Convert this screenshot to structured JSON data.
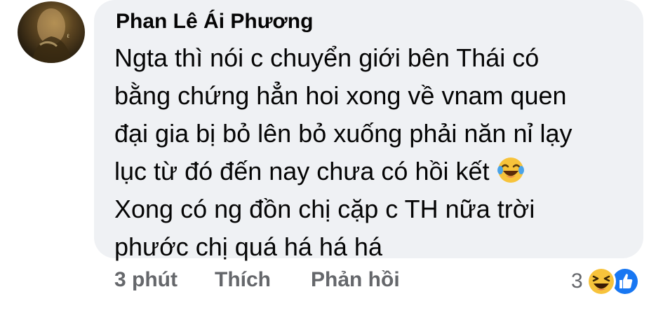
{
  "comment": {
    "author": "Phan Lê Ái Phương",
    "lines": [
      "Ngta thì nói c chuyển giới bên Thái có",
      "bằng chứng hẳn hoi xong về vnam quen",
      "đại gia bị bỏ lên bỏ xuống phải năn nỉ lạy",
      "lục từ đó đến nay chưa có hồi kết",
      "Xong có ng đồn chị cặp c TH nữa trời",
      "phước chị quá há há há"
    ],
    "inline_emoji": "laughing-tears-emoji"
  },
  "actions": {
    "time": "3 phút",
    "like": "Thích",
    "reply": "Phản hồi"
  },
  "reactions": {
    "count": "3",
    "icons": [
      "haha-reaction-icon",
      "like-reaction-icon"
    ]
  },
  "colors": {
    "bubble_bg": "#eff1f4",
    "text": "#050505",
    "secondary_text": "#65676b",
    "like_blue": "#1877f2",
    "emoji_yellow": "#f7c33b"
  }
}
